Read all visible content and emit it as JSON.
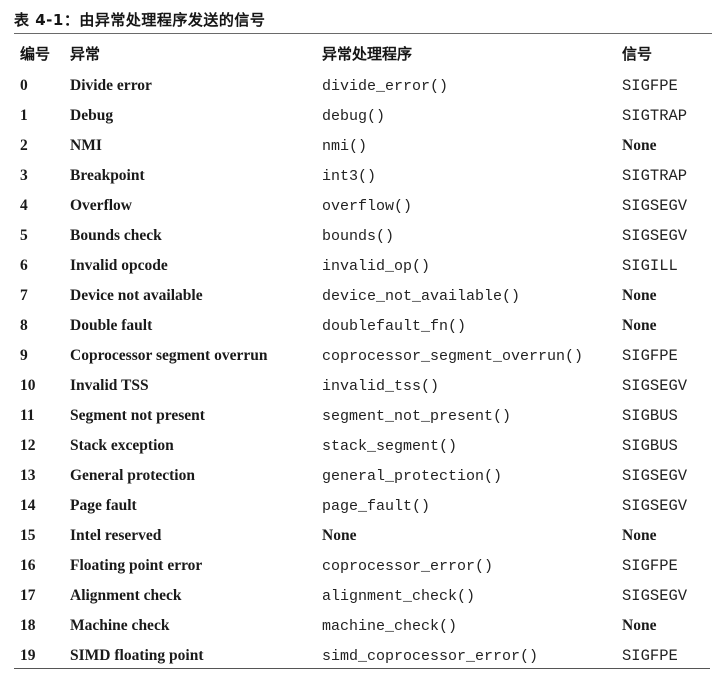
{
  "title": "表 4-1：由异常处理程序发送的信号",
  "table": {
    "headers": {
      "number": "编号",
      "exception": "异常",
      "handler": "异常处理程序",
      "signal": "信号"
    },
    "rows": [
      {
        "number": "0",
        "exception": "Divide error",
        "handler": "divide_error()",
        "signal": "SIGFPE"
      },
      {
        "number": "1",
        "exception": "Debug",
        "handler": "debug()",
        "signal": "SIGTRAP"
      },
      {
        "number": "2",
        "exception": "NMI",
        "handler": "nmi()",
        "signal": "None"
      },
      {
        "number": "3",
        "exception": "Breakpoint",
        "handler": "int3()",
        "signal": "SIGTRAP"
      },
      {
        "number": "4",
        "exception": "Overflow",
        "handler": "overflow()",
        "signal": "SIGSEGV"
      },
      {
        "number": "5",
        "exception": "Bounds check",
        "handler": "bounds()",
        "signal": "SIGSEGV"
      },
      {
        "number": "6",
        "exception": "Invalid opcode",
        "handler": "invalid_op()",
        "signal": "SIGILL"
      },
      {
        "number": "7",
        "exception": "Device not available",
        "handler": "device_not_available()",
        "signal": "None"
      },
      {
        "number": "8",
        "exception": "Double fault",
        "handler": "doublefault_fn()",
        "signal": "None"
      },
      {
        "number": "9",
        "exception": "Coprocessor segment overrun",
        "handler": "coprocessor_segment_overrun()",
        "signal": "SIGFPE"
      },
      {
        "number": "10",
        "exception": "Invalid TSS",
        "handler": "invalid_tss()",
        "signal": "SIGSEGV"
      },
      {
        "number": "11",
        "exception": "Segment not present",
        "handler": "segment_not_present()",
        "signal": "SIGBUS"
      },
      {
        "number": "12",
        "exception": "Stack exception",
        "handler": "stack_segment()",
        "signal": "SIGBUS"
      },
      {
        "number": "13",
        "exception": "General protection",
        "handler": "general_protection()",
        "signal": "SIGSEGV"
      },
      {
        "number": "14",
        "exception": "Page fault",
        "handler": "page_fault()",
        "signal": "SIGSEGV"
      },
      {
        "number": "15",
        "exception": "Intel reserved",
        "handler": "None",
        "signal": "None"
      },
      {
        "number": "16",
        "exception": "Floating point error",
        "handler": "coprocessor_error()",
        "signal": "SIGFPE"
      },
      {
        "number": "17",
        "exception": "Alignment check",
        "handler": "alignment_check()",
        "signal": "SIGSEGV"
      },
      {
        "number": "18",
        "exception": "Machine check",
        "handler": "machine_check()",
        "signal": "None"
      },
      {
        "number": "19",
        "exception": "SIMD floating point",
        "handler": "simd_coprocessor_error()",
        "signal": "SIGFPE"
      }
    ]
  }
}
